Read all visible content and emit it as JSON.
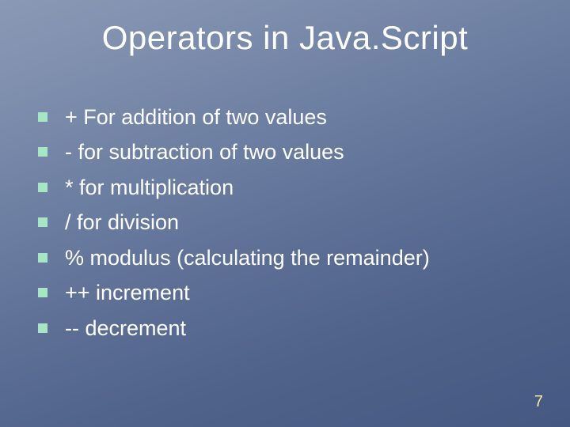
{
  "slide": {
    "title": "Operators in Java.Script",
    "items": [
      "+ For addition of two values",
      "- for subtraction of two values",
      "* for multiplication",
      "/ for division",
      "% modulus (calculating the remainder)",
      "++ increment",
      "-- decrement"
    ],
    "page_number": "7"
  }
}
